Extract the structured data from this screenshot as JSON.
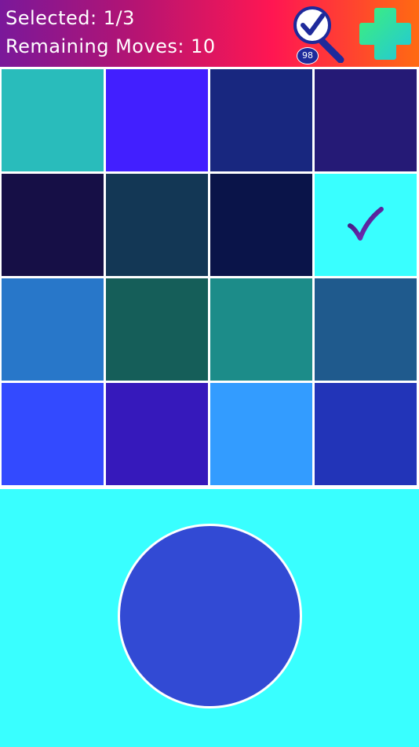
{
  "header": {
    "selected_text": "Selected: 1/3",
    "moves_text": "Remaining Moves: 10",
    "hint_icon": "magnifier-check-icon",
    "hint_count": "98",
    "add_icon": "plus-icon"
  },
  "board": {
    "rows": 4,
    "cols": 4,
    "selected_icon": "checkmark-icon",
    "tiles": [
      {
        "color": "#29bcbb",
        "selected": false
      },
      {
        "color": "#421fff",
        "selected": false
      },
      {
        "color": "#18277f",
        "selected": false
      },
      {
        "color": "#251a76",
        "selected": false
      },
      {
        "color": "#160f46",
        "selected": false
      },
      {
        "color": "#133755",
        "selected": false
      },
      {
        "color": "#0a1449",
        "selected": false
      },
      {
        "color": "#39ffff",
        "selected": true
      },
      {
        "color": "#2877c9",
        "selected": false
      },
      {
        "color": "#155e59",
        "selected": false
      },
      {
        "color": "#1c8c89",
        "selected": false
      },
      {
        "color": "#1f5a8d",
        "selected": false
      },
      {
        "color": "#334aff",
        "selected": false
      },
      {
        "color": "#3619bb",
        "selected": false
      },
      {
        "color": "#339cff",
        "selected": false
      },
      {
        "color": "#2234b8",
        "selected": false
      }
    ]
  },
  "target": {
    "color": "#324ad4",
    "background": "#39ffff"
  }
}
